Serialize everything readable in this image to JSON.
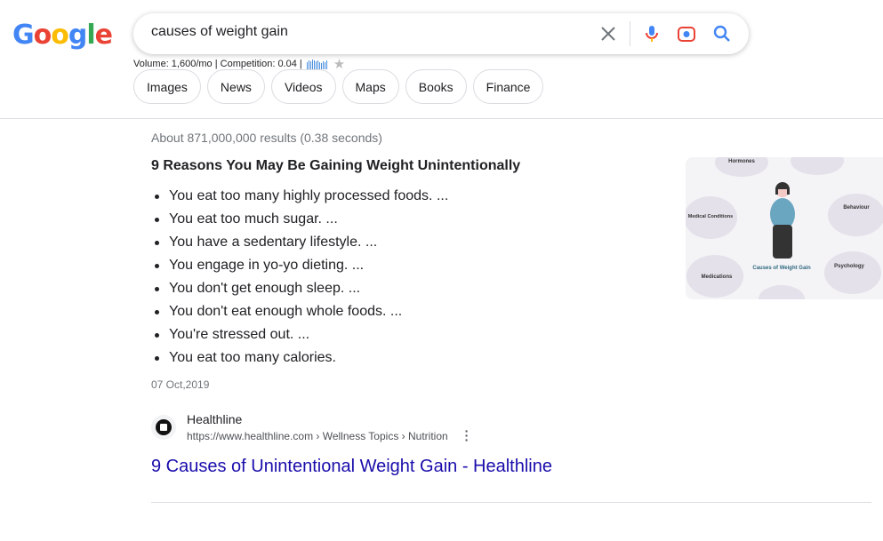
{
  "logo": {
    "letters": [
      "G",
      "o",
      "o",
      "g",
      "l",
      "e"
    ],
    "colors": [
      "#4285f4",
      "#ea4335",
      "#fbbc05",
      "#4285f4",
      "#34a853",
      "#ea4335"
    ]
  },
  "search": {
    "query": "causes of weight gain"
  },
  "keyword_info": {
    "text": "Volume: 1,600/mo | Competition: 0.04 |",
    "bar_levels": [
      0.7,
      0.9,
      0.8,
      1,
      0.9,
      0.8,
      0.9,
      0.7,
      0.6,
      0.8,
      0.7,
      0.9
    ]
  },
  "chips": [
    "Images",
    "News",
    "Videos",
    "Maps",
    "Books",
    "Finance"
  ],
  "stats": "About 871,000,000 results (0.38 seconds)",
  "snippet": {
    "title": "9 Reasons You May Be Gaining Weight Unintentionally",
    "items": [
      "You eat too many highly processed foods. ...",
      "You eat too much sugar. ...",
      "You have a sedentary lifestyle. ...",
      "You engage in yo-yo dieting. ...",
      "You don't get enough sleep. ...",
      "You don't eat enough whole foods. ...",
      "You're stressed out. ...",
      "You eat too many calories."
    ],
    "date": "07 Oct,2019",
    "image": {
      "center": "Causes of Weight Gain",
      "labels": [
        "Hormones",
        "Medical Conditions",
        "Behaviour",
        "Medications",
        "Psychology"
      ]
    }
  },
  "result": {
    "site": "Healthline",
    "url": "https://www.healthline.com › Wellness Topics › Nutrition",
    "title": "9 Causes of Unintentional Weight Gain - Healthline"
  }
}
